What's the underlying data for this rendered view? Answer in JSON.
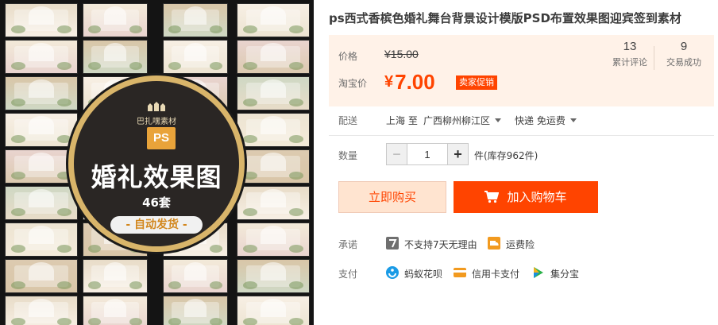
{
  "product": {
    "title": "ps西式香槟色婚礼舞台背景设计模版PSD布置效果图迎宾签到素材",
    "image": {
      "brand": "巴扎嘿素材",
      "format_tag": "PS",
      "headline": "婚礼效果图",
      "count": "46套",
      "delivery": "- 自动发货 -",
      "tile_colors": [
        "#e8dcc8",
        "#f3ead9",
        "#d9c6a8",
        "#f7efe4",
        "#e9d4cf",
        "#cfd8c4",
        "#ede4d2",
        "#dccab0"
      ]
    }
  },
  "price": {
    "label": "价格",
    "original": "¥15.00",
    "taobao_label": "淘宝价",
    "currency": "¥",
    "current": "7.00",
    "promo_tag": "卖家促销"
  },
  "stats": [
    {
      "value": "13",
      "label": "累计评论"
    },
    {
      "value": "9",
      "label": "交易成功"
    }
  ],
  "shipping": {
    "label": "配送",
    "from_to": "上海 至",
    "destination": "广西柳州柳江区",
    "method": "快递 免运费"
  },
  "quantity": {
    "label": "数量",
    "minus": "−",
    "plus": "+",
    "value": "1",
    "stock": "件(库存962件)"
  },
  "actions": {
    "buy_now": "立即购买",
    "add_to_cart": "加入购物车"
  },
  "promise": {
    "label": "承诺",
    "items": [
      "不支持7天无理由",
      "运费险"
    ]
  },
  "payment": {
    "label": "支付",
    "items": [
      "蚂蚁花呗",
      "信用卡支付",
      "集分宝"
    ]
  },
  "colors": {
    "accent": "#ff4400",
    "price_panel_bg": "#fff2e8",
    "badge_ring": "#d9b56a",
    "ps_chip": "#e9a33a"
  }
}
